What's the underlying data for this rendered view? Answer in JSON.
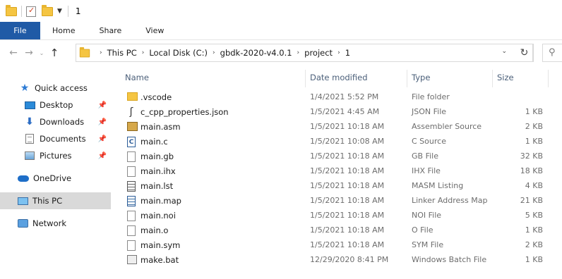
{
  "window": {
    "title": "1"
  },
  "ribbon": {
    "tabs": [
      {
        "label": "File"
      },
      {
        "label": "Home"
      },
      {
        "label": "Share"
      },
      {
        "label": "View"
      }
    ]
  },
  "address": {
    "crumbs": [
      "This PC",
      "Local Disk (C:)",
      "gbdk-2020-v4.0.1",
      "project",
      "1"
    ]
  },
  "nav": {
    "quick_access": "Quick access",
    "desktop": "Desktop",
    "downloads": "Downloads",
    "documents": "Documents",
    "pictures": "Pictures",
    "onedrive": "OneDrive",
    "this_pc": "This PC",
    "network": "Network"
  },
  "columns": {
    "name": "Name",
    "date": "Date modified",
    "type": "Type",
    "size": "Size"
  },
  "files": [
    {
      "icon": "folder-icon",
      "name": ".vscode",
      "date": "1/4/2021 5:52 PM",
      "type": "File folder",
      "size": ""
    },
    {
      "icon": "json-file-icon",
      "name": "c_cpp_properties.json",
      "date": "1/5/2021 4:45 AM",
      "type": "JSON File",
      "size": "1 KB"
    },
    {
      "icon": "assembler-file-icon",
      "name": "main.asm",
      "date": "1/5/2021 10:18 AM",
      "type": "Assembler Source",
      "size": "2 KB"
    },
    {
      "icon": "c-source-icon",
      "name": "main.c",
      "date": "1/5/2021 10:08 AM",
      "type": "C Source",
      "size": "1 KB"
    },
    {
      "icon": "blank-file-icon",
      "name": "main.gb",
      "date": "1/5/2021 10:18 AM",
      "type": "GB File",
      "size": "32 KB"
    },
    {
      "icon": "blank-file-icon",
      "name": "main.ihx",
      "date": "1/5/2021 10:18 AM",
      "type": "IHX File",
      "size": "18 KB"
    },
    {
      "icon": "text-file-icon",
      "name": "main.lst",
      "date": "1/5/2021 10:18 AM",
      "type": "MASM Listing",
      "size": "4 KB"
    },
    {
      "icon": "map-file-icon",
      "name": "main.map",
      "date": "1/5/2021 10:18 AM",
      "type": "Linker Address Map",
      "size": "21 KB"
    },
    {
      "icon": "blank-file-icon",
      "name": "main.noi",
      "date": "1/5/2021 10:18 AM",
      "type": "NOI File",
      "size": "5 KB"
    },
    {
      "icon": "blank-file-icon",
      "name": "main.o",
      "date": "1/5/2021 10:18 AM",
      "type": "O File",
      "size": "1 KB"
    },
    {
      "icon": "blank-file-icon",
      "name": "main.sym",
      "date": "1/5/2021 10:18 AM",
      "type": "SYM File",
      "size": "2 KB"
    },
    {
      "icon": "batch-file-icon",
      "name": "make.bat",
      "date": "12/29/2020 8:41 PM",
      "type": "Windows Batch File",
      "size": "1 KB"
    }
  ]
}
